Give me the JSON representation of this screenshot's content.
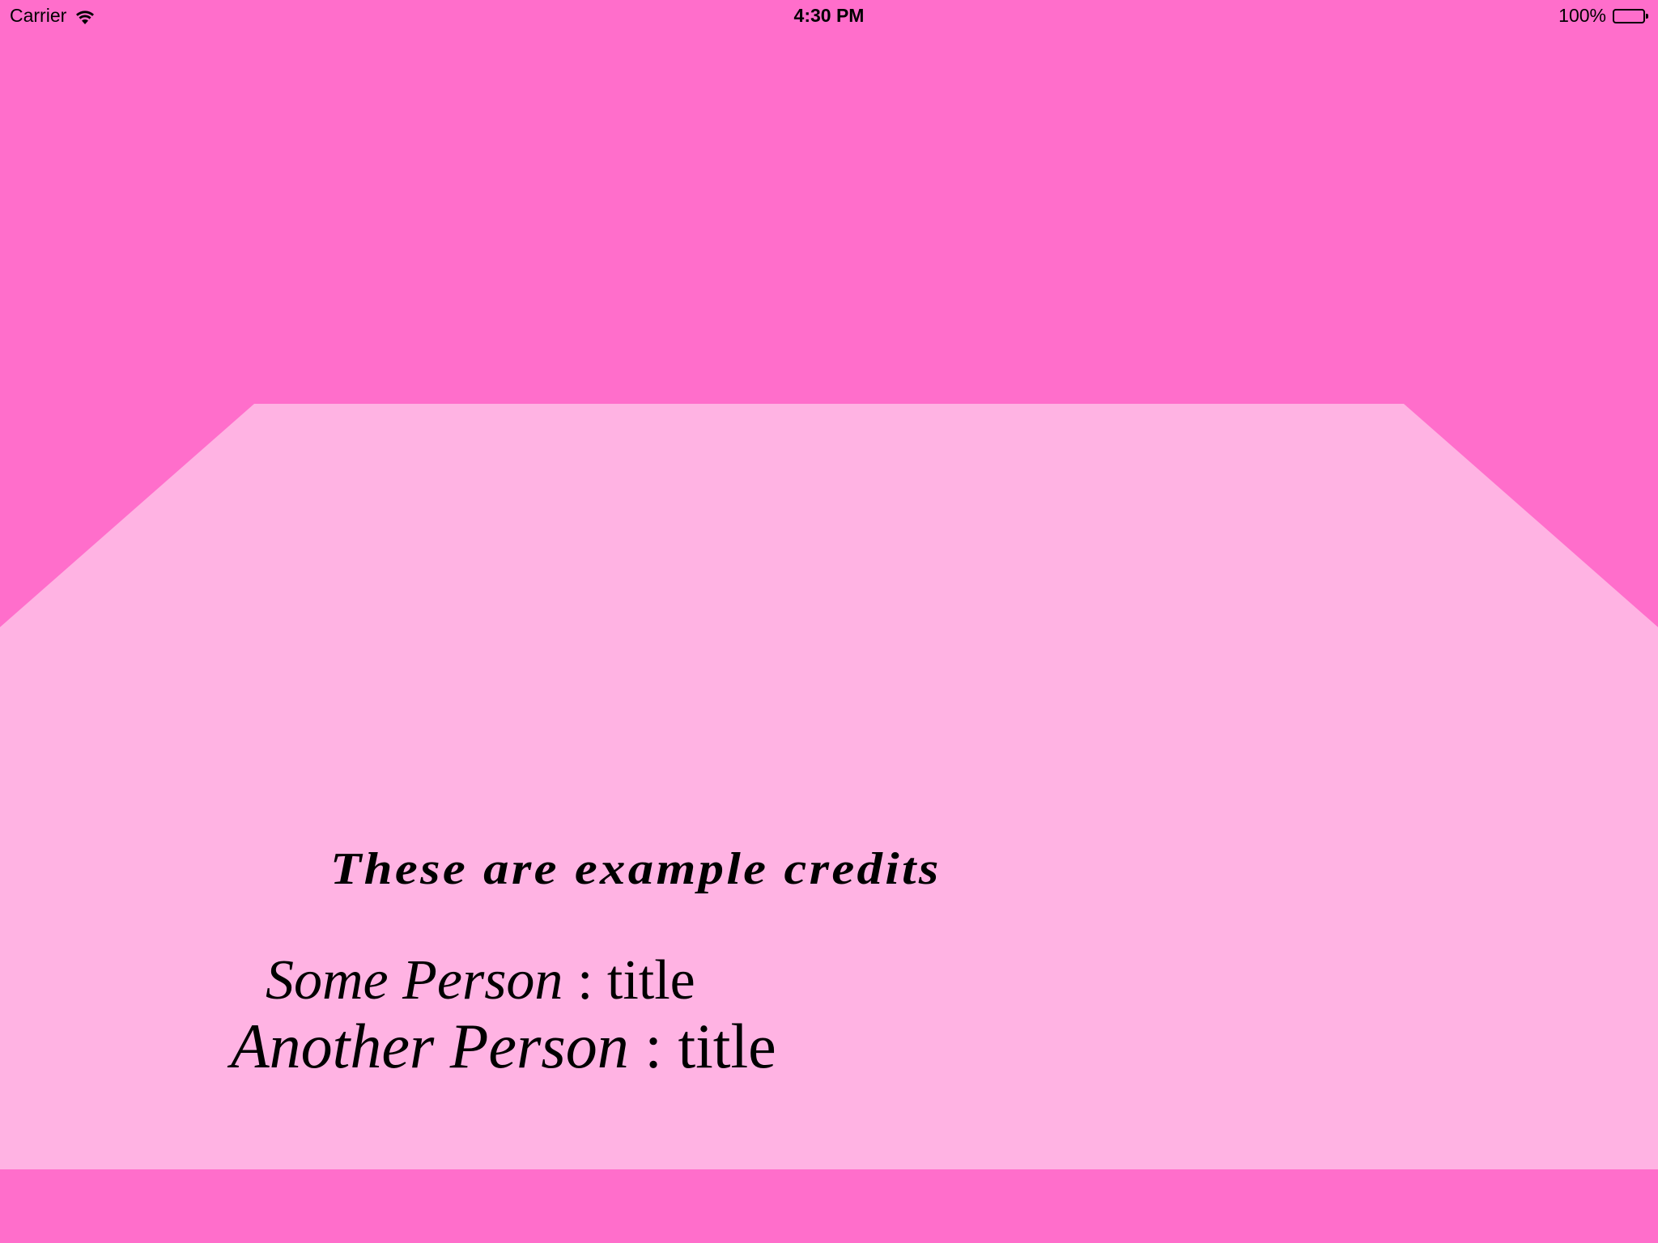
{
  "status_bar": {
    "carrier": "Carrier",
    "time": "4:30 PM",
    "battery_percent": "100%",
    "battery_level": 1.0,
    "wifi_icon": "wifi-icon",
    "battery_icon": "battery-icon"
  },
  "scene": {
    "background_color": "#ff6ecb",
    "floor_color": "#ffb3e3"
  },
  "credits": {
    "heading": "These are example credits",
    "entries": [
      {
        "name": "Some Person",
        "separator": " : ",
        "role": "title"
      },
      {
        "name": "Another Person",
        "separator": " : ",
        "role": "title"
      }
    ]
  }
}
